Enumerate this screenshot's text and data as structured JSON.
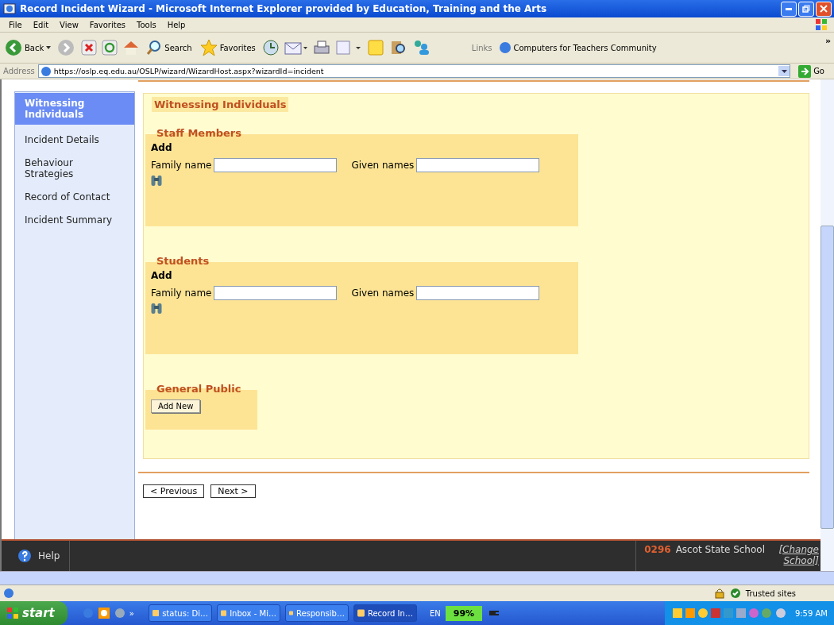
{
  "window": {
    "title": "Record Incident Wizard - Microsoft Internet Explorer provided by Education, Training and the Arts"
  },
  "menu": [
    "File",
    "Edit",
    "View",
    "Favorites",
    "Tools",
    "Help"
  ],
  "toolbar": {
    "back": "Back",
    "search": "Search",
    "favorites": "Favorites",
    "links_label": "Links",
    "link": "Computers for Teachers Community"
  },
  "address": {
    "label": "Address",
    "value": "https://oslp.eq.edu.au/OSLP/wizard/WizardHost.aspx?wizardId=incident",
    "go": "Go"
  },
  "sidebar": {
    "items": [
      {
        "label": "Witnessing Individuals",
        "selected": true
      },
      {
        "label": "Incident Details",
        "selected": false
      },
      {
        "label": "Behaviour Strategies",
        "selected": false
      },
      {
        "label": "Record of Contact",
        "selected": false
      },
      {
        "label": "Incident Summary",
        "selected": false
      }
    ]
  },
  "panel": {
    "title": "Witnessing Individuals",
    "sections": [
      {
        "kind": "name_search",
        "title": "Staff Members",
        "add": "Add",
        "family_label": "Family name",
        "given_label": "Given names"
      },
      {
        "kind": "name_search",
        "title": "Students",
        "add": "Add",
        "family_label": "Family name",
        "given_label": "Given names"
      },
      {
        "kind": "add_button",
        "title": "General Public",
        "button": "Add New"
      }
    ]
  },
  "nav_buttons": [
    "< Previous",
    "Next >"
  ],
  "footer": {
    "help": "Help",
    "school_code": "0296",
    "school_name": "Ascot State School",
    "change_link": "[Change School]"
  },
  "status_bar": {
    "zone": "Trusted sites"
  },
  "taskbar": {
    "start": "start",
    "chevron": "»",
    "tasks": [
      {
        "label": "status: Di…",
        "selected": false
      },
      {
        "label": "Inbox - Mi…",
        "selected": false
      },
      {
        "label": "Responsib…",
        "selected": false
      },
      {
        "label": "Record In…",
        "selected": true
      }
    ],
    "language": "EN",
    "battery": "99%",
    "clock": "9:59 AM"
  }
}
